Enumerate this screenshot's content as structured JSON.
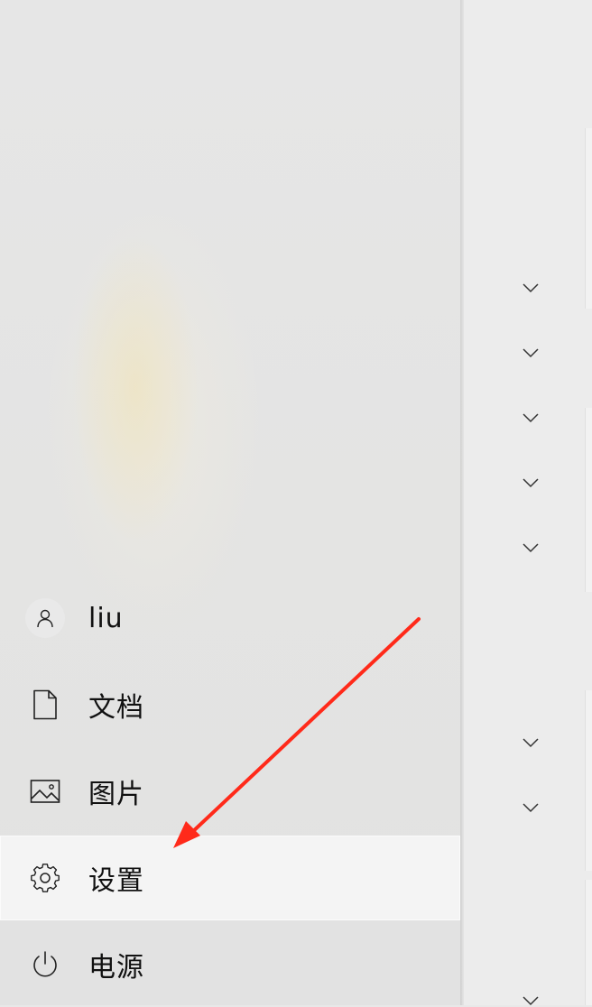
{
  "start_menu": {
    "rail_items": [
      {
        "key": "user",
        "label": "liu",
        "icon": "user-icon"
      },
      {
        "key": "documents",
        "label": "文档",
        "icon": "document-icon"
      },
      {
        "key": "pictures",
        "label": "图片",
        "icon": "picture-icon"
      },
      {
        "key": "settings",
        "label": "设置",
        "icon": "gear-icon",
        "selected": true
      },
      {
        "key": "power",
        "label": "电源",
        "icon": "power-icon"
      }
    ],
    "tile_group_chevrons": [
      "chevron-down-icon",
      "chevron-down-icon",
      "chevron-down-icon",
      "chevron-down-icon",
      "chevron-down-icon",
      "chevron-down-icon",
      "chevron-down-icon",
      "chevron-down-icon"
    ]
  },
  "annotation": {
    "arrow_color": "#ff2a1a",
    "points_to": "settings"
  }
}
